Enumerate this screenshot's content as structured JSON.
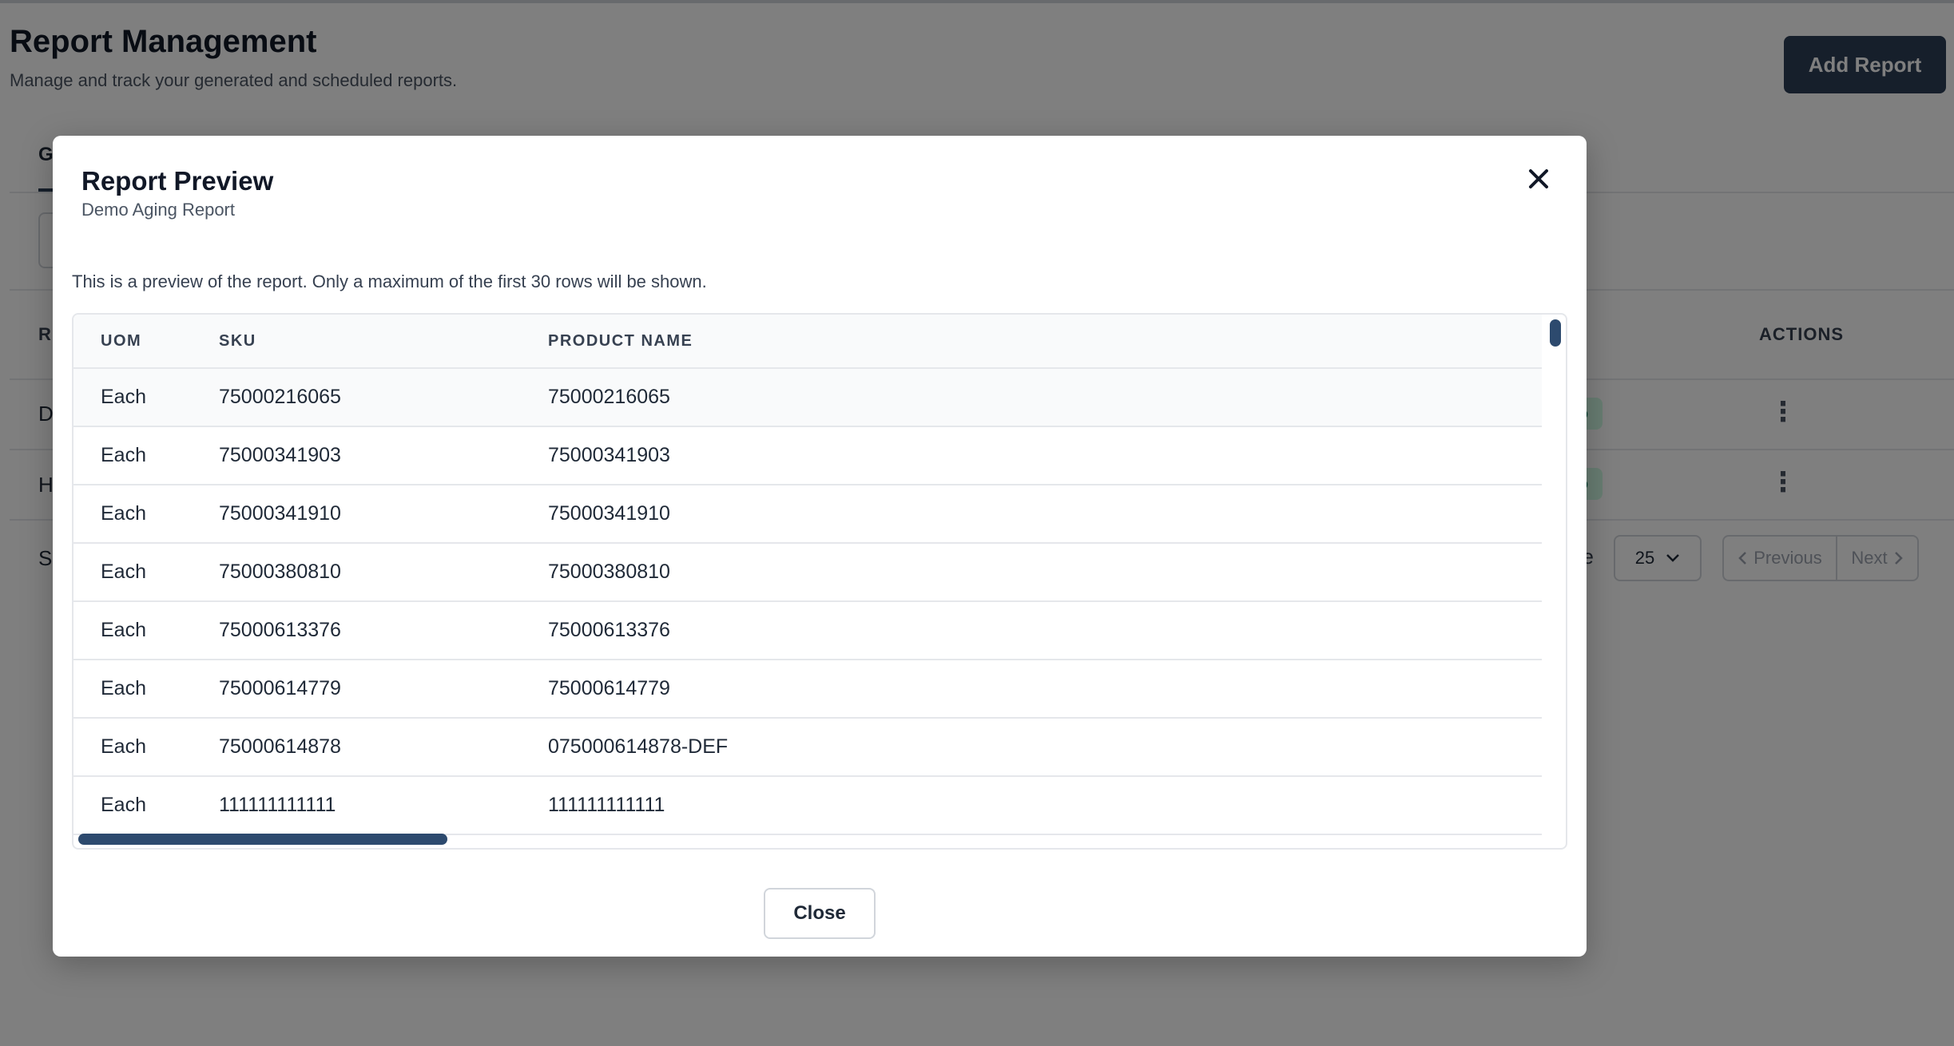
{
  "page": {
    "title": "Report Management",
    "subtitle": "Manage and track your generated and scheduled reports.",
    "add_button": "Add Report",
    "active_tab_partial": "G",
    "table_header_partial": "R",
    "actions_header": "ACTIONS",
    "rows_partial": [
      "D",
      "H"
    ],
    "footer_partial": "S",
    "per_page_label_partial": "ge",
    "per_page_value": "25",
    "prev_label": "Previous",
    "next_label": "Next"
  },
  "modal": {
    "title": "Report Preview",
    "subtitle": "Demo Aging Report",
    "info": "This is a preview of the report. Only a maximum of the first 30 rows will be shown.",
    "close_button": "Close",
    "columns": [
      "UOM",
      "SKU",
      "PRODUCT NAME"
    ],
    "rows": [
      [
        "Each",
        "75000216065",
        "75000216065"
      ],
      [
        "Each",
        "75000341903",
        "75000341903"
      ],
      [
        "Each",
        "75000341910",
        "75000341910"
      ],
      [
        "Each",
        "75000380810",
        "75000380810"
      ],
      [
        "Each",
        "75000613376",
        "75000613376"
      ],
      [
        "Each",
        "75000614779",
        "75000614779"
      ],
      [
        "Each",
        "75000614878",
        "075000614878-DEF"
      ],
      [
        "Each",
        "111111111111",
        "111111111111"
      ]
    ]
  },
  "colors": {
    "primary": "#2d3e57",
    "scrollbar": "#2d4a6e",
    "overlay": "rgba(0,0,0,0.5)"
  }
}
